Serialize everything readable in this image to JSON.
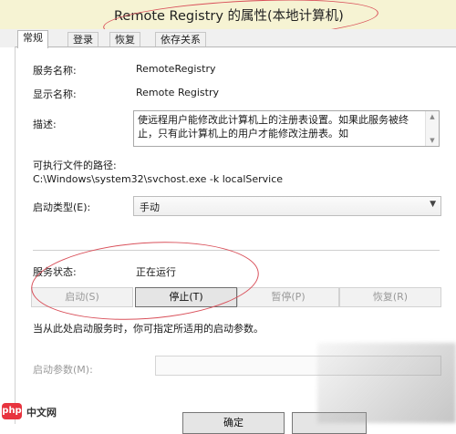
{
  "window": {
    "title": "Remote Registry 的属性(本地计算机)"
  },
  "tabs": [
    {
      "label": "常规"
    },
    {
      "label": "登录"
    },
    {
      "label": "恢复"
    },
    {
      "label": "依存关系"
    }
  ],
  "general": {
    "service_name_label": "服务名称:",
    "service_name": "RemoteRegistry",
    "display_name_label": "显示名称:",
    "display_name": "Remote Registry",
    "description_label": "描述:",
    "description": "使远程用户能修改此计算机上的注册表设置。如果此服务被终止，只有此计算机上的用户才能修改注册表。如",
    "exe_path_label": "可执行文件的路径:",
    "exe_path": "C:\\Windows\\system32\\svchost.exe -k localService",
    "startup_type_label": "启动类型(E):",
    "startup_type": "手动",
    "service_status_label": "服务状态:",
    "service_status": "正在运行",
    "buttons": {
      "start": "启动(S)",
      "stop": "停止(T)",
      "pause": "暂停(P)",
      "resume": "恢复(R)"
    },
    "hint": "当从此处启动服务时，你可指定所适用的启动参数。",
    "start_params_label": "启动参数(M):",
    "start_params_value": ""
  },
  "footer": {
    "ok": "确定"
  },
  "watermark": {
    "logo_text": "中文网",
    "logo_mark": "php"
  },
  "colors": {
    "annotation": "#d9505a",
    "logo": "#e8343f"
  }
}
